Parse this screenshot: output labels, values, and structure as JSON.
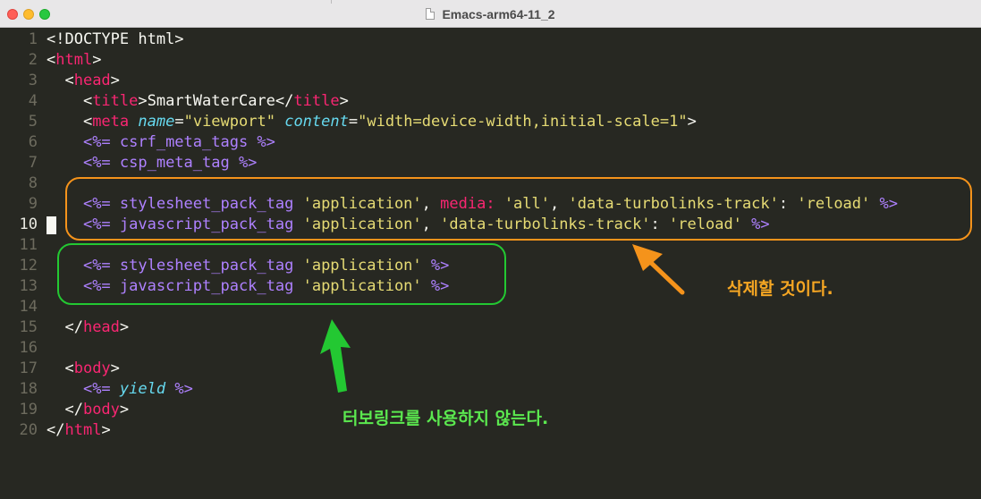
{
  "window": {
    "title": "Emacs-arm64-11_2"
  },
  "colors": {
    "orange": "#f5931b",
    "green": "#23c832",
    "background": "#272822"
  },
  "editor": {
    "current_line": 10,
    "lines": [
      {
        "n": "1",
        "cur": false,
        "tokens": [
          [
            "p",
            "<!DOCTYPE html>"
          ]
        ]
      },
      {
        "n": "2",
        "cur": false,
        "tokens": [
          [
            "p",
            "<"
          ],
          [
            "t",
            "html"
          ],
          [
            "p",
            ">"
          ]
        ]
      },
      {
        "n": "3",
        "cur": false,
        "tokens": [
          [
            "p",
            "  <"
          ],
          [
            "t",
            "head"
          ],
          [
            "p",
            ">"
          ]
        ]
      },
      {
        "n": "4",
        "cur": false,
        "tokens": [
          [
            "p",
            "    <"
          ],
          [
            "t",
            "title"
          ],
          [
            "p",
            ">SmartWaterCare</"
          ],
          [
            "t",
            "title"
          ],
          [
            "p",
            ">"
          ]
        ]
      },
      {
        "n": "5",
        "cur": false,
        "tokens": [
          [
            "p",
            "    <"
          ],
          [
            "t",
            "meta"
          ],
          [
            "p",
            " "
          ],
          [
            "a",
            "name"
          ],
          [
            "p",
            "="
          ],
          [
            "s",
            "\"viewport\""
          ],
          [
            "p",
            " "
          ],
          [
            "a",
            "content"
          ],
          [
            "p",
            "="
          ],
          [
            "s",
            "\"width=device-width,initial-scale=1\""
          ],
          [
            "p",
            ">"
          ]
        ]
      },
      {
        "n": "6",
        "cur": false,
        "tokens": [
          [
            "p",
            "    "
          ],
          [
            "e",
            "<%= csrf_meta_tags %>"
          ]
        ]
      },
      {
        "n": "7",
        "cur": false,
        "tokens": [
          [
            "p",
            "    "
          ],
          [
            "e",
            "<%= csp_meta_tag %>"
          ]
        ]
      },
      {
        "n": "8",
        "cur": false,
        "tokens": []
      },
      {
        "n": "9",
        "cur": false,
        "tokens": [
          [
            "p",
            "    "
          ],
          [
            "e",
            "<%= stylesheet_pack_tag "
          ],
          [
            "s",
            "'application'"
          ],
          [
            "p",
            ", "
          ],
          [
            "sy",
            "media:"
          ],
          [
            "p",
            " "
          ],
          [
            "s",
            "'all'"
          ],
          [
            "p",
            ", "
          ],
          [
            "s",
            "'data-turbolinks-track'"
          ],
          [
            "p",
            ": "
          ],
          [
            "s",
            "'reload'"
          ],
          [
            "e",
            " %>"
          ]
        ]
      },
      {
        "n": "10",
        "cur": true,
        "tokens": [
          [
            "p",
            "    "
          ],
          [
            "e",
            "<%= javascript_pack_tag "
          ],
          [
            "s",
            "'application'"
          ],
          [
            "p",
            ", "
          ],
          [
            "s",
            "'data-turbolinks-track'"
          ],
          [
            "p",
            ": "
          ],
          [
            "s",
            "'reload'"
          ],
          [
            "e",
            " %>"
          ]
        ]
      },
      {
        "n": "11",
        "cur": false,
        "tokens": []
      },
      {
        "n": "12",
        "cur": false,
        "tokens": [
          [
            "p",
            "    "
          ],
          [
            "e",
            "<%= stylesheet_pack_tag "
          ],
          [
            "s",
            "'application'"
          ],
          [
            "e",
            " %>"
          ]
        ]
      },
      {
        "n": "13",
        "cur": false,
        "tokens": [
          [
            "p",
            "    "
          ],
          [
            "e",
            "<%= javascript_pack_tag "
          ],
          [
            "s",
            "'application'"
          ],
          [
            "e",
            " %>"
          ]
        ]
      },
      {
        "n": "14",
        "cur": false,
        "tokens": []
      },
      {
        "n": "15",
        "cur": false,
        "tokens": [
          [
            "p",
            "  </"
          ],
          [
            "t",
            "head"
          ],
          [
            "p",
            ">"
          ]
        ]
      },
      {
        "n": "16",
        "cur": false,
        "tokens": []
      },
      {
        "n": "17",
        "cur": false,
        "tokens": [
          [
            "p",
            "  <"
          ],
          [
            "t",
            "body"
          ],
          [
            "p",
            ">"
          ]
        ]
      },
      {
        "n": "18",
        "cur": false,
        "tokens": [
          [
            "p",
            "    "
          ],
          [
            "e",
            "<%= "
          ],
          [
            "a",
            "yield"
          ],
          [
            "e",
            " %>"
          ]
        ]
      },
      {
        "n": "19",
        "cur": false,
        "tokens": [
          [
            "p",
            "  </"
          ],
          [
            "t",
            "body"
          ],
          [
            "p",
            ">"
          ]
        ]
      },
      {
        "n": "20",
        "cur": false,
        "tokens": [
          [
            "p",
            "</"
          ],
          [
            "t",
            "html"
          ],
          [
            "p",
            ">"
          ]
        ]
      }
    ]
  },
  "annotations": {
    "orange_note": "삭제할 것이다.",
    "green_note": "터보링크를 사용하지 않는다."
  }
}
